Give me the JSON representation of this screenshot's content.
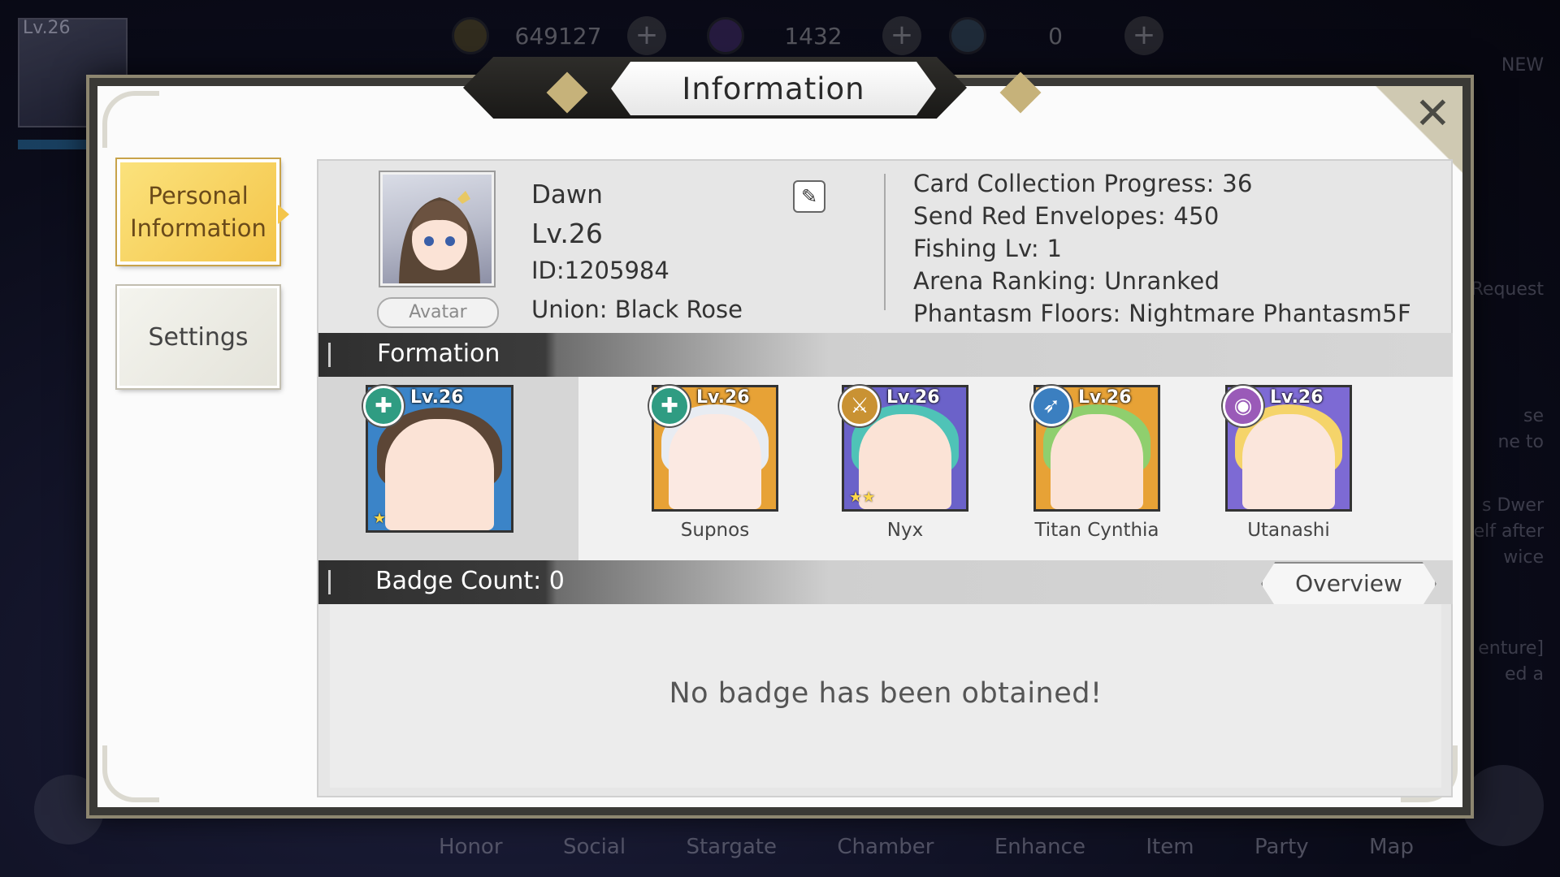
{
  "hud": {
    "player_level": "Lv.26",
    "currencies": [
      {
        "icon": "gold-coin-icon",
        "value": "649127"
      },
      {
        "icon": "purple-gem-icon",
        "value": "1432"
      },
      {
        "icon": "rainbow-orb-icon",
        "value": "0"
      }
    ],
    "nav": [
      "Honor",
      "Social",
      "Stargate",
      "Chamber",
      "Enhance",
      "Item",
      "Party",
      "Map"
    ],
    "right_fragments": [
      "NEW",
      "Request",
      "se",
      "ne to",
      "s Dwer",
      "elf after",
      "wice",
      "enture]",
      "ed a"
    ]
  },
  "modal": {
    "title": "Information",
    "tabs": [
      {
        "label_line1": "Personal",
        "label_line2": "Information",
        "active": true
      },
      {
        "label": "Settings",
        "active": false
      }
    ]
  },
  "profile": {
    "name": "Dawn",
    "level": "Lv.26",
    "id": "ID:1205984",
    "union": "Union: Black Rose",
    "avatar_button": "Avatar",
    "stats": [
      "Card Collection Progress: 36",
      "Send Red Envelopes: 450",
      "Fishing Lv: 1",
      "Arena Ranking: Unranked",
      "Phantasm Floors: Nightmare Phantasm5F"
    ]
  },
  "formation": {
    "title": "Formation",
    "leader": {
      "level": "Lv.26",
      "stars": "★",
      "class_icon": "healer-cross-icon",
      "class_color": "#2f9c82",
      "frame_color": "#3b84c8"
    },
    "cards": [
      {
        "name": "Supnos",
        "level": "Lv.26",
        "stars": "",
        "class_icon": "healer-cross-icon",
        "class_color": "#2f9c82",
        "frame_color": "#e7a236"
      },
      {
        "name": "Nyx",
        "level": "Lv.26",
        "stars": "★★",
        "class_icon": "sword-icon",
        "class_color": "#c99233",
        "frame_color": "#6b62c9"
      },
      {
        "name": "Titan Cynthia",
        "level": "Lv.26",
        "stars": "",
        "class_icon": "bow-icon",
        "class_color": "#3b7fc0",
        "frame_color": "#e7a236"
      },
      {
        "name": "Utanashi",
        "level": "Lv.26",
        "stars": "",
        "class_icon": "mage-orb-icon",
        "class_color": "#9a5ab8",
        "frame_color": "#7d6ad4"
      }
    ]
  },
  "badges": {
    "title": "Badge Count: 0",
    "overview_button": "Overview",
    "empty_message": "No badge has been obtained!"
  }
}
